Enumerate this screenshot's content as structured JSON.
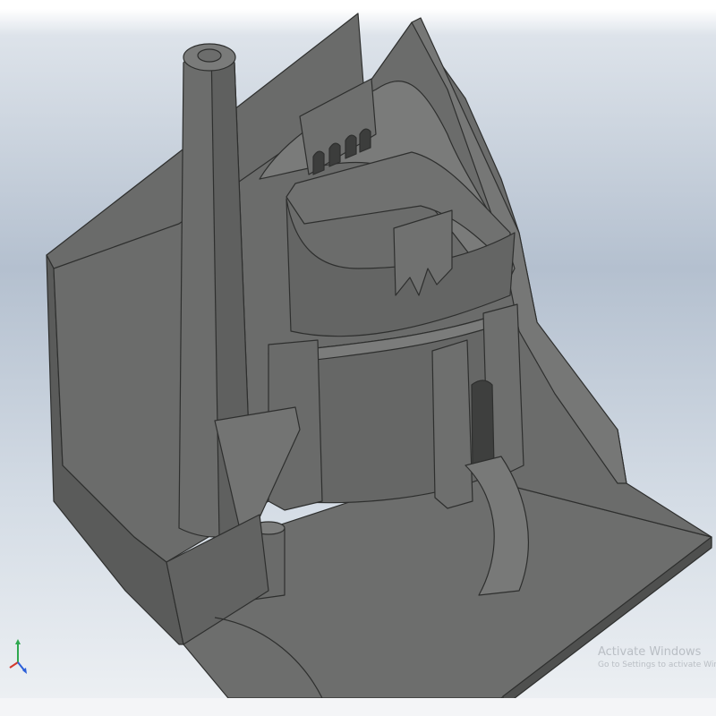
{
  "viewport": {
    "colors": {
      "background_top": "#b4c0cf",
      "background_bottom": "#eef1f4",
      "model_base": "#6b6c6b",
      "model_dark": "#4f504f",
      "model_light": "#7a7b7a",
      "edge_line": "#2e2f2e"
    }
  },
  "triad": {
    "icon": "view-axis-triad-icon",
    "colors": {
      "x": "#d33a2c",
      "y": "#2fa84f",
      "z": "#2b5fd9"
    }
  },
  "watermark": {
    "title": "Activate Windows",
    "subtitle": "Go to Settings to activate Windows."
  }
}
